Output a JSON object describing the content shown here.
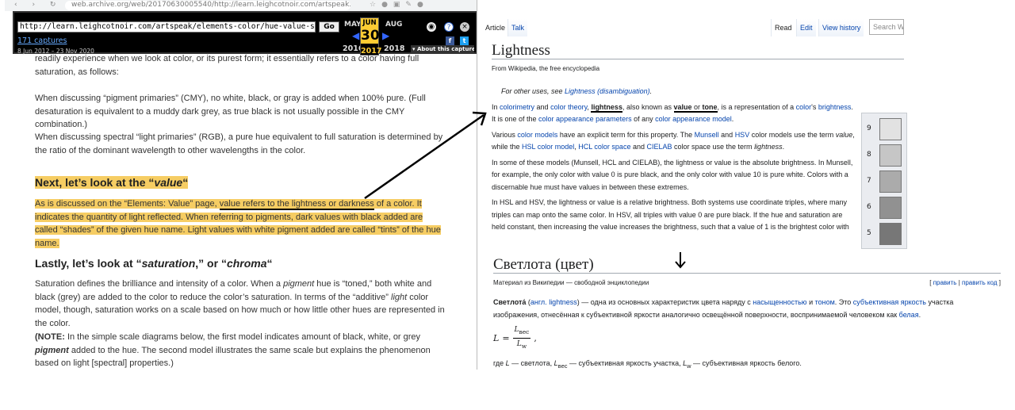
{
  "browser": {
    "url": "web.archive.org/web/20170630005540/http://learn.leighcotnoir.com/artspeak..."
  },
  "wayback": {
    "url_value": "http://learn.leighcotnoir.com/artspeak/elements-color/hue-value-saturation/",
    "go_label": "Go",
    "captures": "171 captures",
    "range": "8 Jun 2012 – 23 Nov 2020",
    "prev_month": "MAY",
    "cur_month": "JUN",
    "next_month": "AUG",
    "cur_day": "30",
    "prev_year": "2016",
    "cur_year": "2017",
    "next_year": "2018",
    "about": "▾ About this capture"
  },
  "article": {
    "p1": "readily experience when we look at color, or its purest form; it essentially refers to a color having full saturation, as follows:",
    "p2": "When discussing “pigment primaries” (CMY), no white, black, or gray is added when 100% pure.  (Full desaturation is equivalent to a muddy dark grey, as true black is not usually possible in the CMY combination.)",
    "p3": "When discussing spectral “light primaries” (RGB), a pure hue equivalent to full saturation is determined by the ratio of the dominant wavelength to other wavelengths in the color.",
    "h_value_pre": "Next, let’s look at the “",
    "h_value_em": "value",
    "h_value_post": "“",
    "p4_a": "As is discussed on the “Elements: Value” page, ",
    "p4_b": "value refers to the lightness or darkness",
    "p4_c": " of a color. It indicates the quantity of light reflected. When referring to pigments, dark values with black added are called “shades” of the given hue name. Light values with white pigment added are called “tints” of the hue name.",
    "h_sat_pre": "Lastly, let’s look at “",
    "h_sat_em": "saturation",
    "h_sat_mid": ",” or “",
    "h_sat_em2": "chroma",
    "h_sat_post": "“",
    "p5_a": "Saturation defines the brilliance and intensity of a color. When a ",
    "p5_em1": "pigment",
    "p5_b": " hue is “toned,” both white and black (grey) are added to the color to reduce the color’s saturation. In terms of the “additive” ",
    "p5_em2": "light",
    "p5_c": " color model, though, saturation works on a scale based on how much or how little other hues are represented in the color.",
    "p6_b": "(NOTE:",
    "p6_a": " In the simple scale diagrams below, the first model indicates amount of black, white, or grey ",
    "p6_em": "pigment",
    "p6_c": " added to the hue. The second model illustrates the same scale but explains the phenomenon based on light [spectral] properties.)"
  },
  "wiki_en": {
    "tab_article": "Article",
    "tab_talk": "Talk",
    "tab_read": "Read",
    "tab_edit": "Edit",
    "tab_history": "View history",
    "search_placeholder": "Search W",
    "title": "Lightness",
    "from": "From Wikipedia, the free encyclopedia",
    "hat_pre": "For other uses, see ",
    "hat_link": "Lightness (disambiguation)",
    "hat_post": ".",
    "p1_a": "In ",
    "p1_l1": "colorimetry",
    "p1_b": " and ",
    "p1_l2": "color theory",
    "p1_c": ", ",
    "p1_bold1": "lightness",
    "p1_d": ", also known as ",
    "p1_bold2": "value",
    "p1_e": " or ",
    "p1_bold3": "tone",
    "p1_f": ", is a representation of a ",
    "p1_l3": "color",
    "p1_g": "'s ",
    "p1_l4": "brightness",
    "p1_h": ". It is one of the ",
    "p1_l5": "color appearance parameters",
    "p1_i": " of any ",
    "p1_l6": "color appearance model",
    "p1_j": ".",
    "p2_a": "Various ",
    "p2_l1": "color models",
    "p2_b": " have an explicit term for this property. The ",
    "p2_l2": "Munsell",
    "p2_c": " and ",
    "p2_l3": "HSV",
    "p2_d": " color models use the term ",
    "p2_em1": "value",
    "p2_e": ", while the ",
    "p2_l4": "HSL color model",
    "p2_f": ", ",
    "p2_l5": "HCL color space",
    "p2_g": " and ",
    "p2_l6": "CIELAB",
    "p2_h": " color space use the term ",
    "p2_em2": "lightness",
    "p2_i": ".",
    "p3": "In some of these models (Munsell, HCL and CIELAB), the lightness or value is the absolute brightness. In Munsell, for example, the only color with value 0 is pure black, and the only color with value 10 is pure white. Colors with a discernable hue must have values in between these extremes.",
    "p4": "In HSL and HSV, the lightness or value is a relative brightness. Both systems use coordinate triples, where many triples can map onto the same color. In HSV, all triples with value 0 are pure black. If the hue and saturation are held constant, then increasing the value increases the brightness, such that a value of 1 is the brightest color with the given hue and saturation. HSL is similar, except that all triples with",
    "scale": [
      {
        "label": "9",
        "color": "#e2e2e2"
      },
      {
        "label": "8",
        "color": "#c6c6c6"
      },
      {
        "label": "7",
        "color": "#ababab"
      },
      {
        "label": "6",
        "color": "#919191"
      },
      {
        "label": "5",
        "color": "#777777"
      }
    ]
  },
  "wiki_ru": {
    "title": "Светлота (цвет)",
    "sub": "Материал из Википедии — свободной энциклопедии",
    "edit_open": "[ ",
    "edit_l1": "править",
    "edit_sep": " | ",
    "edit_l2": "править код",
    "edit_close": " ]",
    "p1_bold": "Светлота́",
    "p1_a": " (",
    "p1_l1": "англ. lightness",
    "p1_b": ") — одна из основных характеристик цвета наряду с ",
    "p1_l2": "насыщенностью",
    "p1_c": " и ",
    "p1_l3": "тоном",
    "p1_d": ". Это ",
    "p1_l4": "субъективная яркость",
    "p1_e": " участка изображения, отнесённая к субъективной яркости аналогично освещённой поверхности, воспринимаемой человеком как ",
    "p1_l5": "белая",
    "p1_f": ".",
    "f_lhs": "L",
    "f_eq": "=",
    "f_num": "L",
    "f_num_sub": "вес",
    "f_den": "L",
    "f_den_sub": "w",
    "f_end": ",",
    "p2_a": "где ",
    "p2_v1": "L",
    "p2_b": " — светлота, ",
    "p2_v2": "L",
    "p2_v2_sub": "вес",
    "p2_c": " — субъективная яркость участка, ",
    "p2_v3": "L",
    "p2_v3_sub": "w",
    "p2_d": " — субъективная яркость белого."
  }
}
